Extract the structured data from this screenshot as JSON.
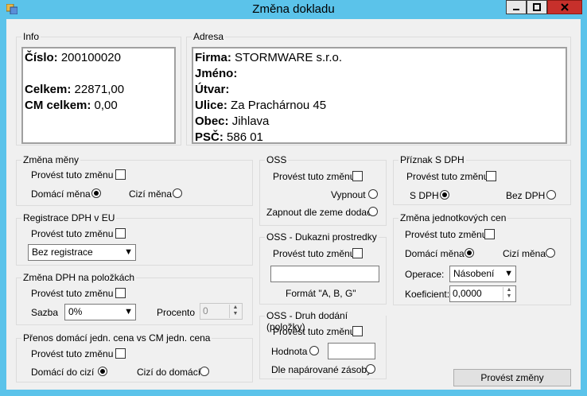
{
  "window": {
    "title": "Změna dokladu",
    "min_label": "▁",
    "max_label": "☐",
    "close_label": "✕"
  },
  "info": {
    "group_label": "Info",
    "cislo_label": "Číslo:",
    "cislo_value": "200100020",
    "celkem_label": "Celkem:",
    "celkem_value": "22871,00",
    "cm_label": "CM celkem:",
    "cm_value": "0,00"
  },
  "adresa": {
    "group_label": "Adresa",
    "firma_label": "Firma:",
    "firma_value": "STORMWARE s.r.o.",
    "jmeno_label": "Jméno:",
    "utvar_label": "Útvar:",
    "ulice_label": "Ulice:",
    "ulice_value": "Za Prachárnou 45",
    "obec_label": "Obec:",
    "obec_value": "Jihlava",
    "psc_label": "PSČ:",
    "psc_value": "586 01"
  },
  "zmena_meny": {
    "group_label": "Změna měny",
    "apply_label": "Provést tuto změnu",
    "domaci_label": "Domácí měna",
    "cizi_label": "Cizí měna"
  },
  "registrace": {
    "group_label": "Registrace DPH v EU",
    "apply_label": "Provést tuto změnu",
    "combo_value": "Bez registrace"
  },
  "zmena_dph": {
    "group_label": "Změna DPH na položkách",
    "apply_label": "Provést tuto změnu",
    "sazba_label": "Sazba",
    "sazba_value": "0%",
    "procento_label": "Procento",
    "procento_value": "0"
  },
  "prenos": {
    "group_label": "Přenos domácí jedn. cena vs CM jedn. cena",
    "apply_label": "Provést tuto změnu",
    "domaci_do_cizi": "Domácí  do cizí",
    "cizi_do_domaci": "Cizí do domácí"
  },
  "oss": {
    "group_label": "OSS",
    "apply_label": "Provést tuto změnu",
    "vypnout_label": "Vypnout",
    "zapnout_label": "Zapnout dle zeme dodaci"
  },
  "oss_dukazni": {
    "group_label": "OSS - Dukazni prostredky",
    "apply_label": "Provést tuto změnu",
    "input_value": "",
    "format_label": "Formát \"A, B, G\""
  },
  "oss_druh": {
    "group_label": "OSS - Druh dodání (položky)",
    "apply_label": "Provést tuto změnu",
    "hodnota_label": "Hodnota",
    "hodnota_value": "",
    "naparovane_label": "Dle napárované zásoby"
  },
  "priznak": {
    "group_label": "Příznak S DPH",
    "apply_label": "Provést tuto změnu",
    "s_dph_label": "S DPH",
    "bez_dph_label": "Bez DPH"
  },
  "jednotkove": {
    "group_label": "Změna jednotkových cen",
    "apply_label": "Provést tuto změnu",
    "domaci_label": "Domácí měna",
    "cizi_label": "Cizí měna",
    "operace_label": "Operace:",
    "operace_value": "Násobení",
    "koeficient_label": "Koeficient:",
    "koeficient_value": "0,0000"
  },
  "actions": {
    "submit_label": "Provést změny"
  }
}
